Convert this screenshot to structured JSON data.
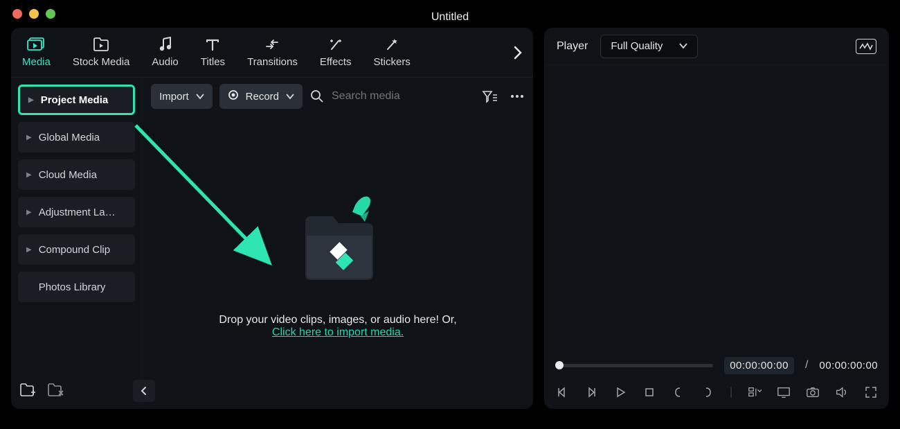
{
  "window": {
    "title": "Untitled"
  },
  "tabs": {
    "items": [
      {
        "label": "Media"
      },
      {
        "label": "Stock Media"
      },
      {
        "label": "Audio"
      },
      {
        "label": "Titles"
      },
      {
        "label": "Transitions"
      },
      {
        "label": "Effects"
      },
      {
        "label": "Stickers"
      }
    ],
    "active_index": 0
  },
  "sidebar": {
    "items": [
      {
        "label": "Project Media",
        "has_children": true
      },
      {
        "label": "Global Media",
        "has_children": true
      },
      {
        "label": "Cloud Media",
        "has_children": true
      },
      {
        "label": "Adjustment La…",
        "has_children": true
      },
      {
        "label": "Compound Clip",
        "has_children": true
      },
      {
        "label": "Photos Library",
        "has_children": false
      }
    ],
    "active_index": 0
  },
  "toolbar": {
    "import_label": "Import",
    "record_label": "Record",
    "search_placeholder": "Search media"
  },
  "dropzone": {
    "line1": "Drop your video clips, images, or audio here! Or,",
    "link": "Click here to import media."
  },
  "player": {
    "label": "Player",
    "quality_options": [
      "Full Quality"
    ],
    "quality_selected": "Full Quality",
    "current_time": "00:00:00:00",
    "total_time": "00:00:00:00"
  },
  "colors": {
    "accent": "#2ee5b2"
  }
}
